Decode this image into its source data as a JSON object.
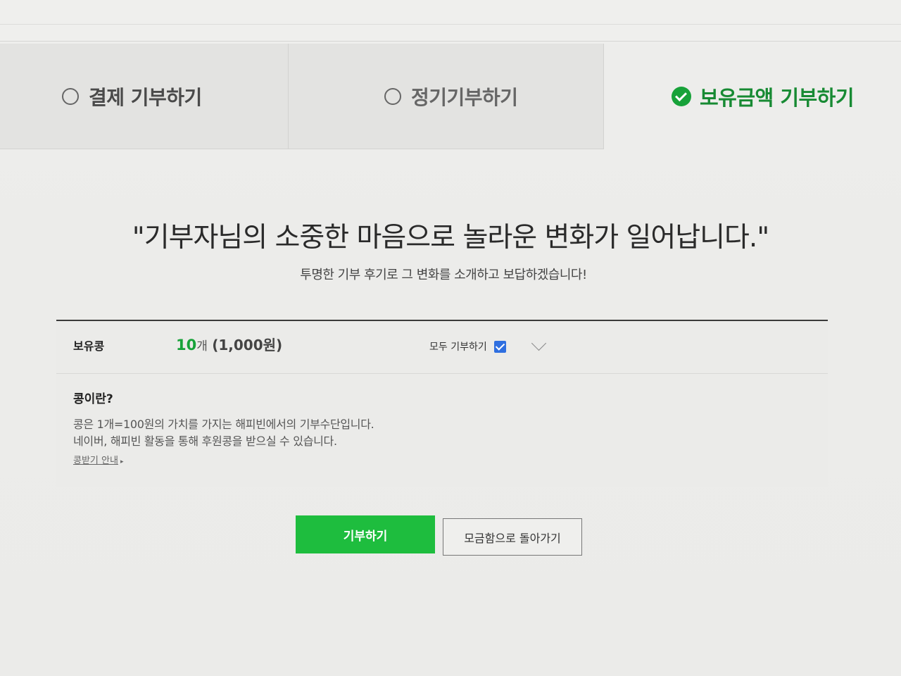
{
  "tabs": [
    {
      "label": "결제 기부하기",
      "selected": false
    },
    {
      "label": "정기기부하기",
      "selected": false
    },
    {
      "label": "보유금액 기부하기",
      "selected": true
    }
  ],
  "headline": "\"기부자님의 소중한 마음으로 놀라운 변화가 일어납니다.\"",
  "subline": "투명한 기부 후기로 그 변화를 소개하고 보답하겠습니다!",
  "balance": {
    "label": "보유콩",
    "count": "10",
    "unit": "개",
    "won": "(1,000원)",
    "all_donate_label": "모두 기부하기",
    "all_donate_checked": true
  },
  "info": {
    "title": "콩이란?",
    "line1": "콩은 1개=100원의 가치를 가지는 해피빈에서의 기부수단입니다.",
    "line2": "네이버, 해피빈 활동을 통해 후원콩을 받으실 수 있습니다.",
    "link": "콩받기 안내"
  },
  "buttons": {
    "donate": "기부하기",
    "back": "모금함으로 돌아가기"
  },
  "colors": {
    "accent": "#17a239",
    "donate_button": "#1ebd3e",
    "checkbox": "#2f6fe0"
  },
  "icons": {
    "tab_unselected": "radio-empty-icon",
    "tab_selected": "check-circle-icon",
    "checkbox": "checkbox-checked-icon",
    "expand": "chevron-down-icon",
    "link_arrow": "triangle-right-icon"
  }
}
